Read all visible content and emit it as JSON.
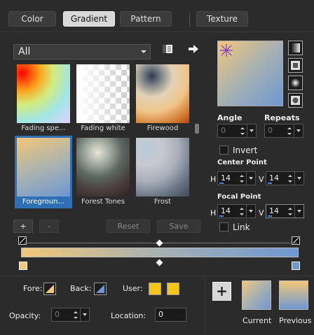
{
  "tabs": [
    "Color",
    "Gradient",
    "Pattern",
    "Texture"
  ],
  "active_tab": "Gradient",
  "category": {
    "value": "All"
  },
  "gradients": [
    {
      "label": "Fading spe..."
    },
    {
      "label": "Fading white"
    },
    {
      "label": "Firewood"
    },
    {
      "label": "Foregroun..."
    },
    {
      "label": "Forest Tones"
    },
    {
      "label": "Frost"
    }
  ],
  "selected_gradient": "Foregroun...",
  "buttons": {
    "add": "+",
    "remove": "-",
    "reset": "Reset",
    "save": "Save"
  },
  "fields": {
    "angle": {
      "label": "Angle",
      "value": "0"
    },
    "repeats": {
      "label": "Repeats",
      "value": "0"
    },
    "invert": {
      "label": "Invert"
    },
    "center_point": {
      "label": "Center Point",
      "h_label": "H",
      "h": "14",
      "v_label": "V",
      "v": "14"
    },
    "focal_point": {
      "label": "Focal Point",
      "h_label": "H",
      "h": "14",
      "v_label": "V",
      "v": "14"
    },
    "link": {
      "label": "Link"
    }
  },
  "stops": {
    "fore": {
      "label": "Fore:",
      "color": "#f2c779"
    },
    "back": {
      "label": "Back:",
      "color": "#6e97d2"
    },
    "user": {
      "label": "User:",
      "color": "#f5c518"
    },
    "opacity": {
      "label": "Opacity:",
      "value": "0"
    },
    "location": {
      "label": "Location:",
      "value": "0"
    }
  },
  "materials": {
    "current": "Current",
    "previous": "Previous"
  },
  "colors": {
    "gradient_start": "#f2c779",
    "gradient_mid": "#a6b1b3",
    "gradient_end": "#6e97d2",
    "selection": "#2f6fb5"
  }
}
